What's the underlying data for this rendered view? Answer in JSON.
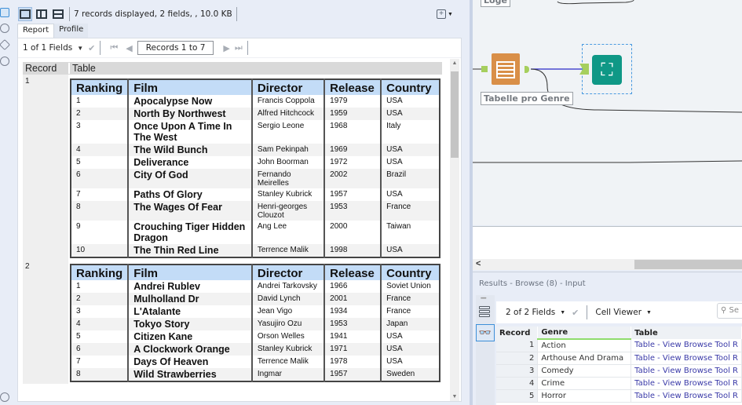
{
  "left_panel": {
    "status": "7 records displayed, 2 fields, , 10.0 KB",
    "tabs": [
      {
        "label": "Report"
      },
      {
        "label": "Profile"
      }
    ],
    "fields_selector": "1 of 1 Fields",
    "records_label": "Records 1 to 7",
    "header": {
      "record": "Record",
      "table": "Table"
    },
    "column_headers": [
      "Ranking",
      "Film",
      "Director",
      "Release",
      "Country"
    ],
    "records": [
      {
        "number": "1",
        "rows": [
          {
            "ranking": "1",
            "film": "Apocalypse Now",
            "director": "Francis Coppola",
            "release": "1979",
            "country": "USA"
          },
          {
            "ranking": "2",
            "film": "North By Northwest",
            "director": "Alfred Hitchcock",
            "release": "1959",
            "country": "USA"
          },
          {
            "ranking": "3",
            "film": "Once Upon A Time In The West",
            "director": "Sergio Leone",
            "release": "1968",
            "country": "Italy"
          },
          {
            "ranking": "4",
            "film": "The Wild Bunch",
            "director": "Sam Pekinpah",
            "release": "1969",
            "country": "USA"
          },
          {
            "ranking": "5",
            "film": "Deliverance",
            "director": "John Boorman",
            "release": "1972",
            "country": "USA"
          },
          {
            "ranking": "6",
            "film": "City Of God",
            "director": "Fernando Meirelles",
            "release": "2002",
            "country": "Brazil"
          },
          {
            "ranking": "7",
            "film": "Paths Of Glory",
            "director": "Stanley Kubrick",
            "release": "1957",
            "country": "USA"
          },
          {
            "ranking": "8",
            "film": "The Wages Of Fear",
            "director": "Henri-georges Clouzot",
            "release": "1953",
            "country": "France"
          },
          {
            "ranking": "9",
            "film": "Crouching Tiger Hidden Dragon",
            "director": "Ang Lee",
            "release": "2000",
            "country": "Taiwan"
          },
          {
            "ranking": "10",
            "film": "The Thin Red Line",
            "director": "Terrence Malik",
            "release": "1998",
            "country": "USA"
          }
        ]
      },
      {
        "number": "2",
        "rows": [
          {
            "ranking": "1",
            "film": "Andrei Rublev",
            "director": "Andrei Tarkovsky",
            "release": "1966",
            "country": "Soviet Union"
          },
          {
            "ranking": "2",
            "film": "Mulholland Dr",
            "director": "David Lynch",
            "release": "2001",
            "country": "France"
          },
          {
            "ranking": "3",
            "film": "L'Atalante",
            "director": "Jean Vigo",
            "release": "1934",
            "country": "France"
          },
          {
            "ranking": "4",
            "film": "Tokyo Story",
            "director": "Yasujiro Ozu",
            "release": "1953",
            "country": "Japan"
          },
          {
            "ranking": "5",
            "film": "Citizen Kane",
            "director": "Orson Welles",
            "release": "1941",
            "country": "USA"
          },
          {
            "ranking": "6",
            "film": "A Clockwork Orange",
            "director": "Stanley Kubrick",
            "release": "1971",
            "country": "USA"
          },
          {
            "ranking": "7",
            "film": "Days Of Heaven",
            "director": "Terrence Malik",
            "release": "1978",
            "country": "USA"
          },
          {
            "ranking": "8",
            "film": "Wild Strawberries",
            "director": "Ingmar",
            "release": "1957",
            "country": "Sweden"
          }
        ]
      }
    ]
  },
  "canvas": {
    "top_label_fragment": "Loge",
    "table_node_label": "Tabelle pro Genre",
    "colors": {
      "table_node": "#d98f48",
      "browse_node": "#0f9886",
      "anchor": "#a6cf5e",
      "selection": "#4a9ae0"
    }
  },
  "results": {
    "title": "Results - Browse (8) - Input",
    "fields_selector": "2 of 2 Fields",
    "cell_viewer": "Cell Viewer",
    "search_placeholder": "Se",
    "columns": [
      "Record",
      "Genre",
      "Table"
    ],
    "rows": [
      {
        "record": "1",
        "genre": "Action",
        "table": "Table - View Browse Tool R"
      },
      {
        "record": "2",
        "genre": "Arthouse And Drama",
        "table": "Table - View Browse Tool R"
      },
      {
        "record": "3",
        "genre": "Comedy",
        "table": "Table - View Browse Tool R"
      },
      {
        "record": "4",
        "genre": "Crime",
        "table": "Table - View Browse Tool R"
      },
      {
        "record": "5",
        "genre": "Horror",
        "table": "Table - View Browse Tool R"
      }
    ]
  }
}
